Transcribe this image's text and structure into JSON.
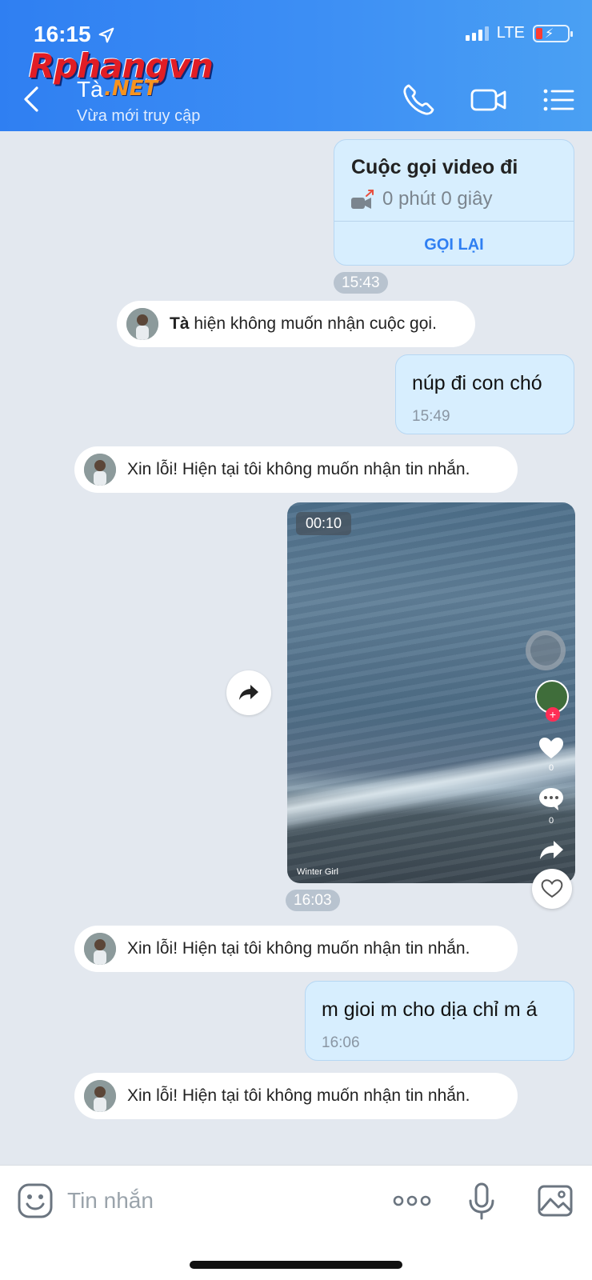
{
  "status_bar": {
    "time": "16:15",
    "network": "LTE"
  },
  "watermark": {
    "brand": "Rphangvn",
    "suffix": ".NET"
  },
  "header": {
    "contact_name": "Tà",
    "contact_status": "Vừa mới truy cập"
  },
  "call_card": {
    "title": "Cuộc gọi video đi",
    "duration": "0 phút 0 giây",
    "action": "GỌI LẠI",
    "time": "15:43"
  },
  "system_messages": [
    {
      "name": "Tà",
      "text": " hiện không muốn nhận cuộc gọi."
    },
    {
      "text": "Xin lỗi! Hiện tại tôi không muốn nhận tin nhắn."
    },
    {
      "text": "Xin lỗi! Hiện tại tôi không muốn nhận tin nhắn."
    },
    {
      "text": "Xin lỗi! Hiện tại tôi không muốn nhận tin nhắn."
    }
  ],
  "messages": [
    {
      "text": "núp đi con chó",
      "time": "15:49"
    },
    {
      "text": "m gioi m cho dịa chỉ m á",
      "time": "16:06"
    }
  ],
  "video": {
    "duration": "00:10",
    "time": "16:03",
    "likes": "0",
    "comments": "0",
    "credit": "Winter Girl"
  },
  "input": {
    "placeholder": "Tin nhắn"
  },
  "icons": {
    "header": [
      "back-icon",
      "phone-icon",
      "video-call-icon",
      "menu-icon"
    ],
    "input": [
      "sticker-icon",
      "more-icon",
      "mic-icon",
      "image-icon"
    ]
  },
  "colors": {
    "header": "#2f7ff2",
    "bubble_out": "#d7eefe",
    "background": "#e3e8ef",
    "action": "#2f7ff2"
  }
}
